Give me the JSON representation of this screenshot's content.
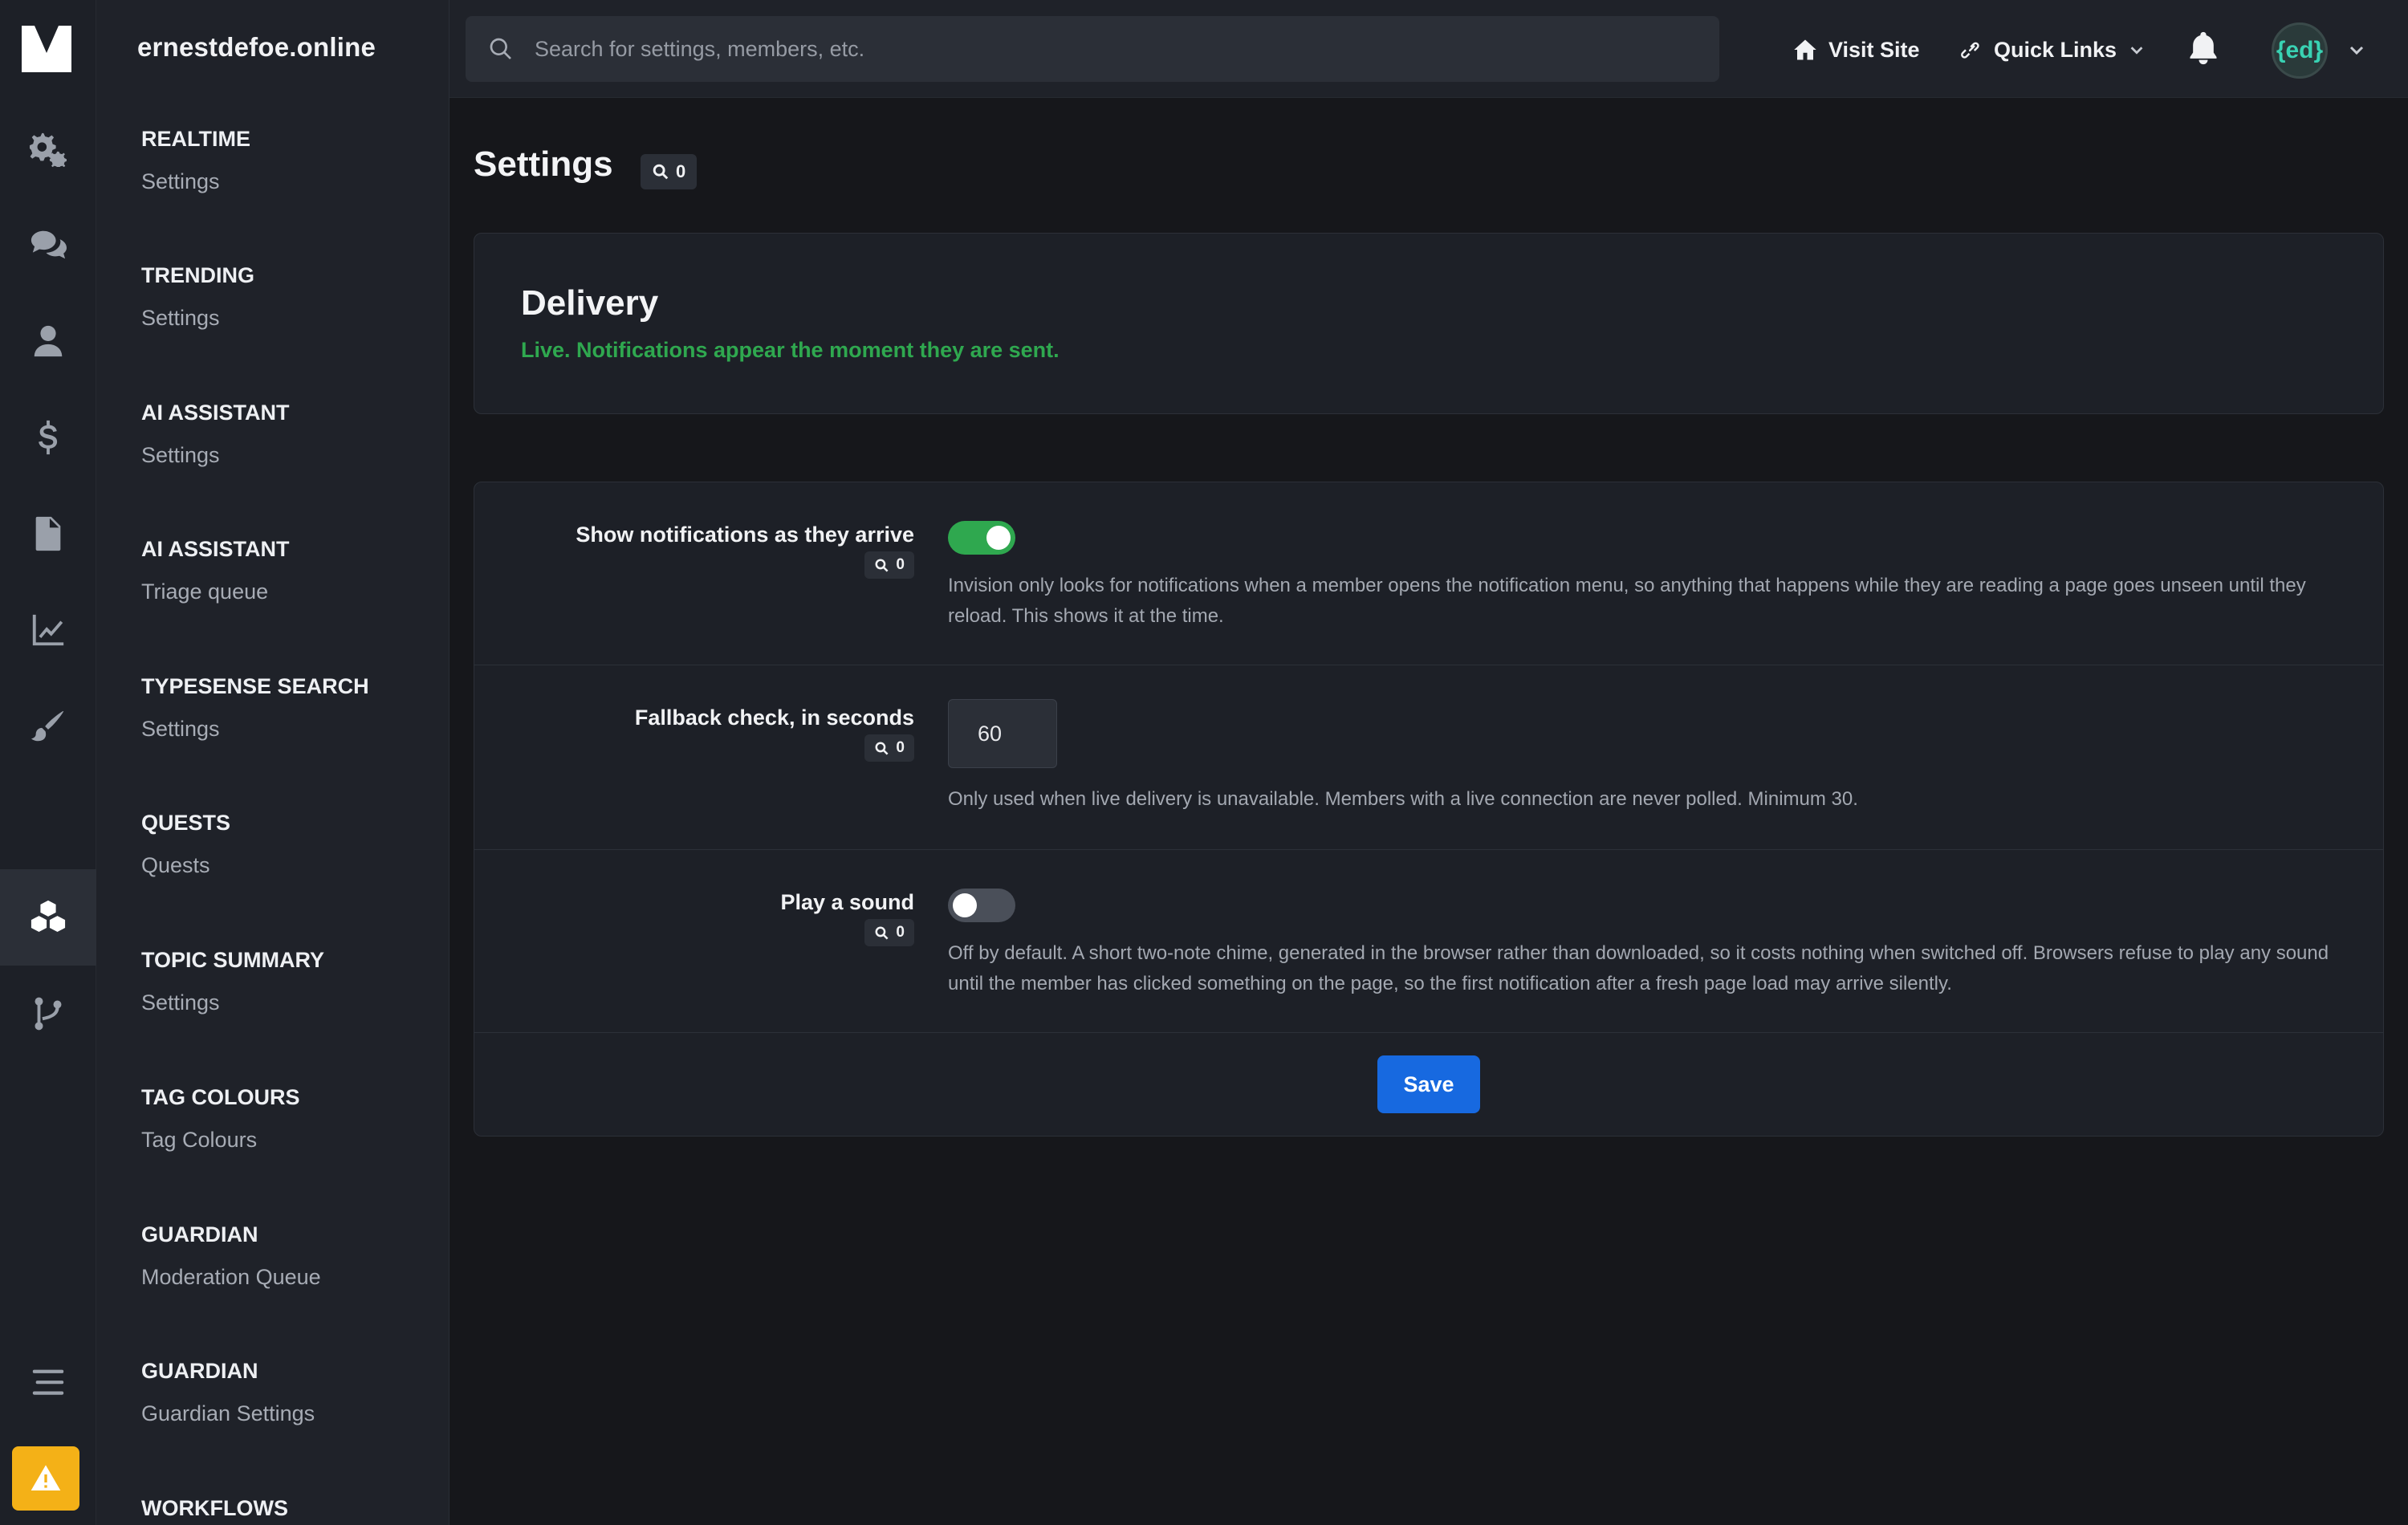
{
  "site_name": "ernestdefoe.online",
  "search": {
    "placeholder": "Search for settings, members, etc."
  },
  "topbar": {
    "visit_site": "Visit Site",
    "quick_links": "Quick Links",
    "avatar_text": "{ed}"
  },
  "sidebar": {
    "groups": [
      {
        "heading": "Realtime",
        "item": "Settings"
      },
      {
        "heading": "Trending",
        "item": "Settings"
      },
      {
        "heading": "AI Assistant",
        "item": "Settings"
      },
      {
        "heading": "AI Assistant",
        "item": "Triage queue"
      },
      {
        "heading": "Typesense Search",
        "item": "Settings"
      },
      {
        "heading": "Quests",
        "item": "Quests"
      },
      {
        "heading": "Topic Summary",
        "item": "Settings"
      },
      {
        "heading": "Tag Colours",
        "item": "Tag Colours"
      },
      {
        "heading": "Guardian",
        "item": "Moderation Queue"
      },
      {
        "heading": "Guardian",
        "item": "Guardian Settings"
      },
      {
        "heading": "Workflows",
        "item": ""
      }
    ]
  },
  "page": {
    "title": "Settings",
    "search_count": "0"
  },
  "delivery": {
    "title": "Delivery",
    "subtitle": "Live. Notifications appear the moment they are sent."
  },
  "settings": {
    "rows": [
      {
        "label": "Show notifications as they arrive",
        "badge": "0",
        "enabled": true,
        "help": "Invision only looks for notifications when a member opens the notification menu, so anything that happens while they are reading a page goes unseen until they reload. This shows it at the time."
      },
      {
        "label": "Fallback check, in seconds",
        "badge": "0",
        "value": "60",
        "help": "Only used when live delivery is unavailable. Members with a live connection are never polled. Minimum 30."
      },
      {
        "label": "Play a sound",
        "badge": "0",
        "enabled": false,
        "help": "Off by default. A short two-note chime, generated in the browser rather than downloaded, so it costs nothing when switched off. Browsers refuse to play any sound until the member has clicked something on the page, so the first notification after a fresh page load may arrive silently."
      }
    ],
    "save_label": "Save"
  },
  "colors": {
    "accent_green": "#2fa84f",
    "primary_blue": "#1769e0",
    "warning_yellow": "#f4b117"
  },
  "icons": {
    "rail": [
      "logo-icon",
      "gears-icon",
      "chat-bubbles-icon",
      "user-icon",
      "dollar-icon",
      "file-icon",
      "chart-line-icon",
      "brush-icon",
      "cubes-icon",
      "branch-icon",
      "menu-icon",
      "warning-icon"
    ]
  }
}
